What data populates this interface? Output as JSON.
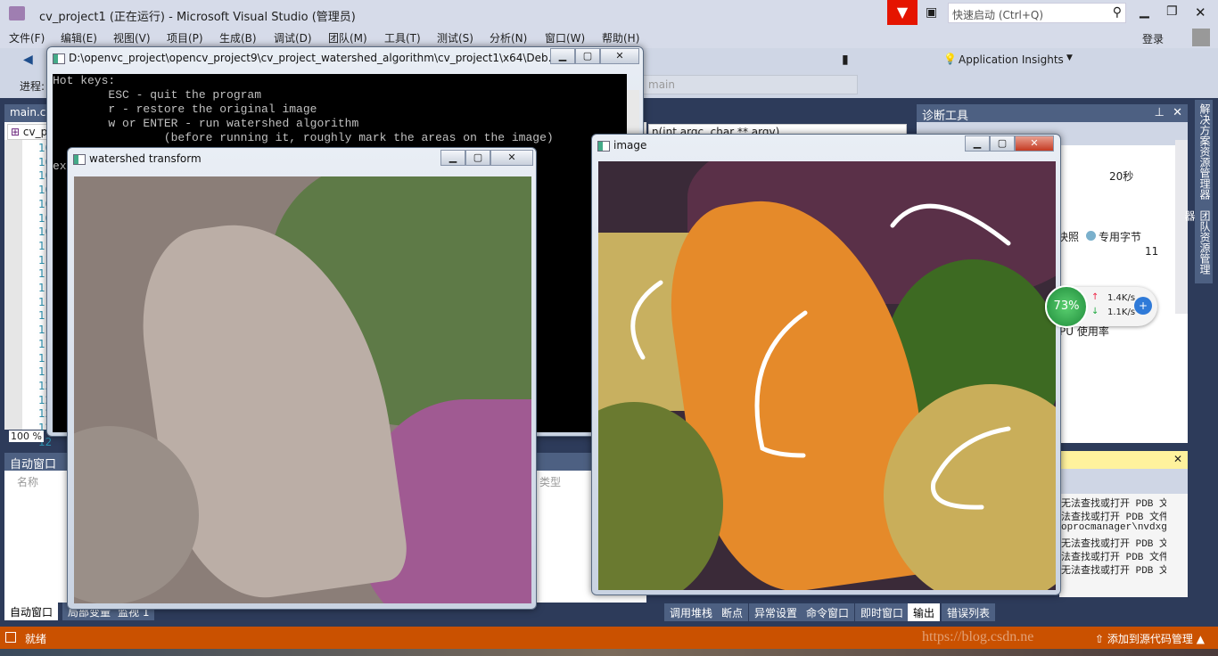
{
  "title": "cv_project1 (正在运行) - Microsoft Visual Studio (管理员)",
  "quick_launch_placeholder": "快速启动 (Ctrl+Q)",
  "signin": "登录",
  "menu": [
    "文件(F)",
    "编辑(E)",
    "视图(V)",
    "项目(P)",
    "生成(B)",
    "调试(D)",
    "团队(M)",
    "工具(T)",
    "测试(S)",
    "分析(N)",
    "窗口(W)",
    "帮助(H)"
  ],
  "toolbar": {
    "app_insights": "Application Insights",
    "process_label": "进程:",
    "func_combo": "main"
  },
  "editor": {
    "tab": "main.cpp",
    "scope": "cv_p",
    "signature": "n(int argc, char ** argv)",
    "zoom": "100 %",
    "line_numbers": [
      "10",
      "10",
      "10",
      "10",
      "10",
      "10",
      "10",
      "11",
      "11",
      "11",
      "11",
      "11",
      "11",
      "11",
      "11",
      "11",
      "11",
      "12",
      "12",
      "12",
      "12",
      "12"
    ]
  },
  "console": {
    "title": "D:\\openvc_project\\opencv_project9\\cv_project_watershed_algorithm\\cv_project1\\x64\\Deb...",
    "lines": [
      "Hot keys:",
      "        ESC - quit the program",
      "        r - restore the original image",
      "        w or ENTER - run watershed algorithm",
      "                (before running it, roughly mark the areas on the image)",
      "",
      "ex"
    ]
  },
  "watershed_window": {
    "title": "watershed transform"
  },
  "image_window": {
    "title": "image"
  },
  "diagnostics": {
    "title": "诊断工具",
    "time": "20秒",
    "legend_snapshot": "快照",
    "legend_private": "专用字节",
    "value": "11",
    "cpu": "PU 使用率"
  },
  "net_widget": {
    "percent": "73%",
    "up": "1.4K/s",
    "down": "1.1K/s"
  },
  "autos": {
    "title": "自动窗口",
    "col_name": "名称",
    "col_type": "类型",
    "tabs": [
      "自动窗口",
      "局部变量",
      "监视 1"
    ]
  },
  "output": {
    "lines": [
      "无法查找或打开 PDB 文件",
      "法查找或打开 PDB 文件",
      "oprocmanager\\nvdxgiwr",
      "无法查找或打开 PDB 文件",
      "法查找或打开 PDB 文件",
      "无法查找或打开 PDB 文件"
    ]
  },
  "bottom_tabs": [
    "调用堆栈",
    "断点",
    "异常设置",
    "命令窗口",
    "即时窗口",
    "输出",
    "错误列表"
  ],
  "side_tabs": [
    "解决方案资源管理器",
    "团队资源管理器"
  ],
  "status": {
    "text": "就绪",
    "watermark": "https://blog.csdn.ne",
    "source_control": "添加到源代码管理"
  },
  "colors": {
    "status_bar": "#ca5100",
    "chrome": "#d6dbe9",
    "dark": "#2d3b5a",
    "accent_red": "#e51400"
  }
}
